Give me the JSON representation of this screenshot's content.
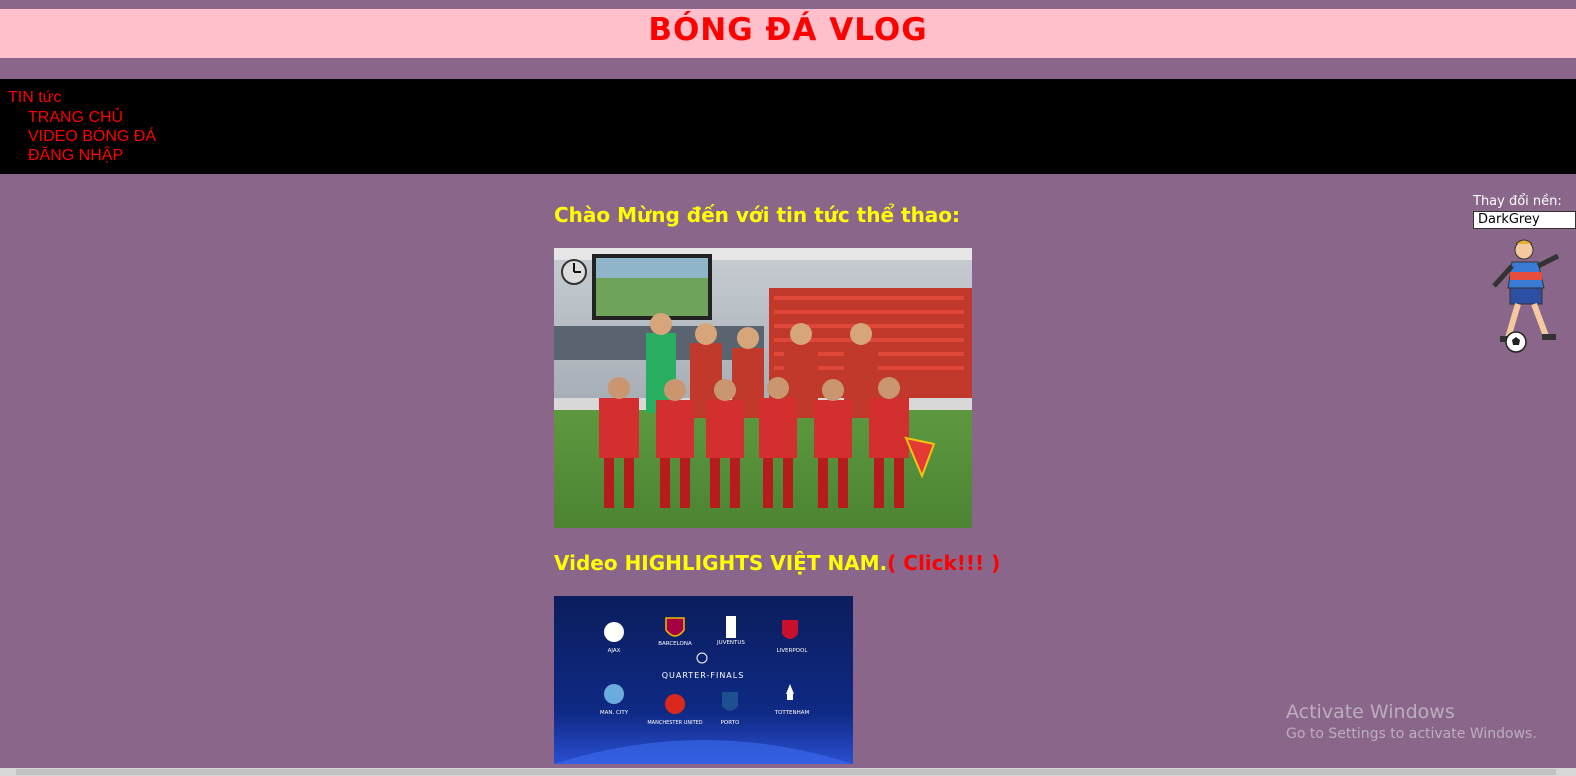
{
  "header": {
    "title": "BÓNG ĐÁ VLOG"
  },
  "nav": {
    "top_item": "TIN tức",
    "sub_items": [
      "TRANG CHỦ",
      "VIDEO BÓNG ĐÁ",
      "ĐĂNG NHẬP"
    ]
  },
  "main": {
    "welcome": "Chào Mừng đến với tin tức thể thao:",
    "video_label": "Video HIGHLIGHTS VIỆT NAM.",
    "video_click": "( Click!!! )",
    "ucl": {
      "clubs_top": [
        "AJAX",
        "BARCELONA",
        "JUVENTUS",
        "LIVERPOOL"
      ],
      "round": "QUARTER-FINALS",
      "clubs_bottom": [
        "MAN. CITY",
        "MANCHESTER UNITED",
        "PORTO",
        "TOTTENHAM"
      ]
    }
  },
  "sidebar": {
    "bg_label": "Thay đổi nền:",
    "bg_value": "DarkGrey"
  },
  "watermark": {
    "line1": "Activate Windows",
    "line2": "Go to Settings to activate Windows."
  },
  "colors": {
    "page_bg": "#8a668b",
    "header_bg": "#ffc0cb",
    "nav_bg": "#000000",
    "accent_red": "#ff0000",
    "heading_yellow": "#ffff00"
  }
}
